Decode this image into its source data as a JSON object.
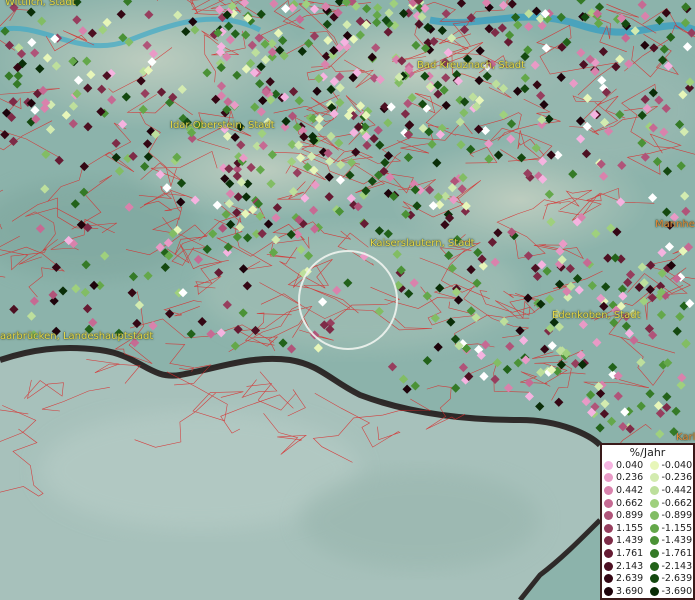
{
  "cities": [
    {
      "name": "Wittlich, Stadt"
    },
    {
      "name": "Bad Kreuznach, Stadt"
    },
    {
      "name": "Idar-Oberstein, Stadt"
    },
    {
      "name": "Kaiserslautern, Stadt"
    },
    {
      "name": "Mannhe"
    },
    {
      "name": "aarbrücken, Landeshauptstadt"
    },
    {
      "name": "Edenkoben, Stadt"
    },
    {
      "name": "Karl"
    }
  ],
  "legend": {
    "title": "%/Jahr",
    "rows": [
      {
        "pos": "0.040",
        "neg": "-0.040",
        "pos_color": "#f5b3e0",
        "neg_color": "#e7f6b9"
      },
      {
        "pos": "0.236",
        "neg": "-0.236",
        "pos_color": "#e99ac6",
        "neg_color": "#d3ebb0"
      },
      {
        "pos": "0.442",
        "neg": "-0.442",
        "pos_color": "#d982ac",
        "neg_color": "#bddf9c"
      },
      {
        "pos": "0.662",
        "neg": "-0.662",
        "pos_color": "#c66a93",
        "neg_color": "#9fd07d"
      },
      {
        "pos": "0.899",
        "neg": "-0.899",
        "pos_color": "#b05479",
        "neg_color": "#82bd64"
      },
      {
        "pos": "1.155",
        "neg": "-1.155",
        "pos_color": "#973e5e",
        "neg_color": "#64a84a"
      },
      {
        "pos": "1.439",
        "neg": "-1.439",
        "pos_color": "#7e2b47",
        "neg_color": "#4b9236"
      },
      {
        "pos": "1.761",
        "neg": "-1.761",
        "pos_color": "#661b33",
        "neg_color": "#357a27"
      },
      {
        "pos": "2.143",
        "neg": "-2.143",
        "pos_color": "#4d1022",
        "neg_color": "#22621a"
      },
      {
        "pos": "2.639",
        "neg": "-2.639",
        "pos_color": "#340714",
        "neg_color": "#144910"
      },
      {
        "pos": "3.690",
        "neg": "-3.690",
        "pos_color": "#1e030b",
        "neg_color": "#0a2e08"
      }
    ]
  }
}
